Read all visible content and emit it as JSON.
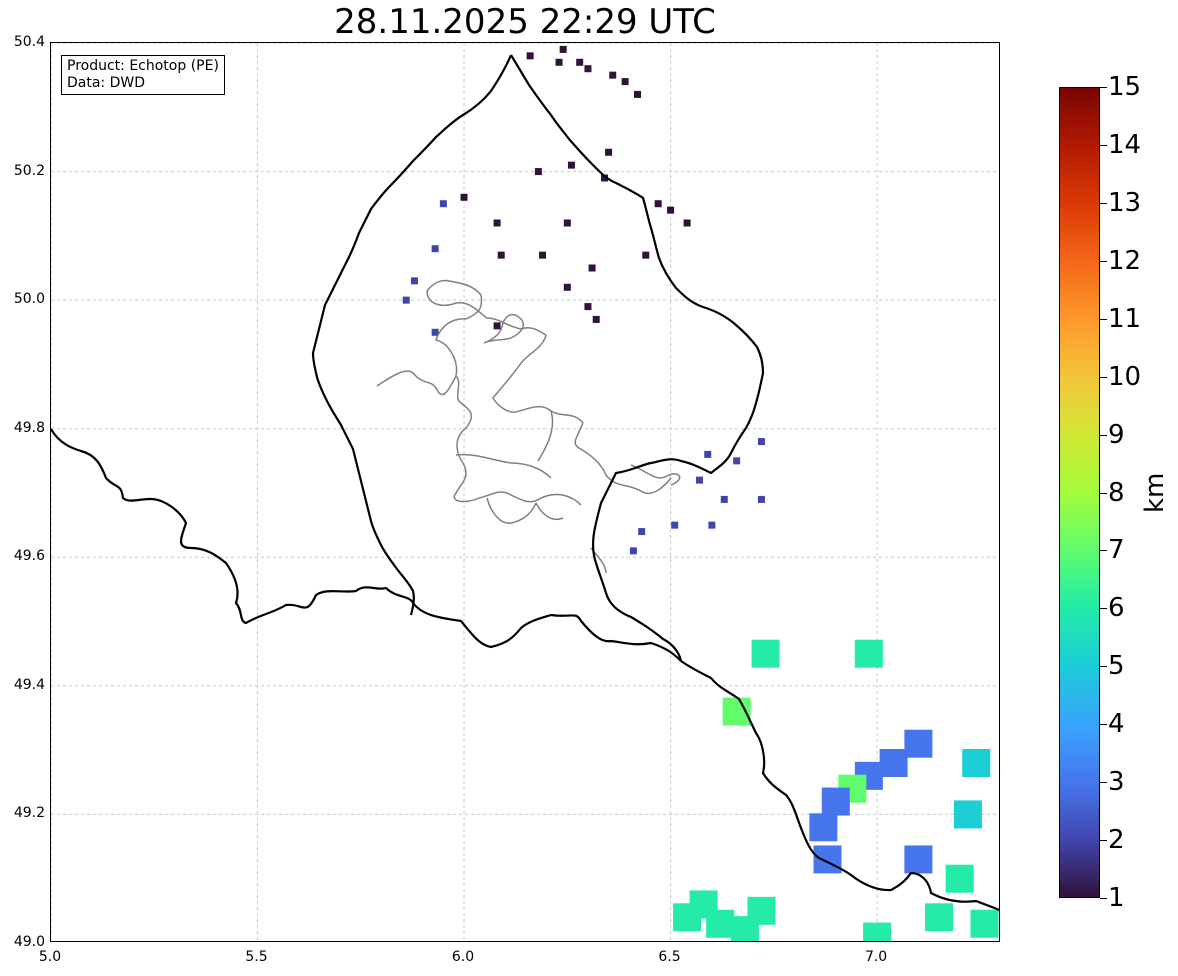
{
  "title": "28.11.2025 22:29 UTC",
  "info_box": {
    "product": "Product: Echotop (PE)",
    "data": "Data: DWD"
  },
  "axes": {
    "lon_ticks": [
      "5.0",
      "5.5",
      "6.0",
      "6.5",
      "7.0"
    ],
    "lat_ticks": [
      "50.4",
      "50.2",
      "50.0",
      "49.8",
      "49.6",
      "49.4",
      "49.2",
      "49.0"
    ],
    "lon_range": [
      5.0,
      7.3
    ],
    "lat_range": [
      49.0,
      50.4
    ],
    "grid": true
  },
  "colorbar": {
    "label": "km",
    "ticks": [
      "15",
      "14",
      "13",
      "12",
      "11",
      "10",
      "9",
      "8",
      "7",
      "6",
      "5",
      "4",
      "3",
      "2",
      "1"
    ],
    "range": [
      1,
      15
    ],
    "colormap": "turbo"
  },
  "chart_data": {
    "type": "heatmap",
    "title": "28.11.2025 22:29 UTC",
    "xlabel": "",
    "ylabel": "",
    "xlim": [
      5.0,
      7.3
    ],
    "ylim": [
      49.0,
      50.4
    ],
    "unit": "km",
    "cells": [
      {
        "lon": 6.16,
        "lat": 50.38,
        "value": 1.2
      },
      {
        "lon": 6.24,
        "lat": 50.39,
        "value": 1.2
      },
      {
        "lon": 6.28,
        "lat": 50.37,
        "value": 1.2
      },
      {
        "lon": 6.36,
        "lat": 50.35,
        "value": 1.3
      },
      {
        "lon": 6.23,
        "lat": 50.37,
        "value": 1.2
      },
      {
        "lon": 6.39,
        "lat": 50.34,
        "value": 1.2
      },
      {
        "lon": 6.42,
        "lat": 50.32,
        "value": 1.3
      },
      {
        "lon": 6.3,
        "lat": 50.36,
        "value": 1.2
      },
      {
        "lon": 6.18,
        "lat": 50.2,
        "value": 1.2
      },
      {
        "lon": 6.26,
        "lat": 50.21,
        "value": 1.2
      },
      {
        "lon": 6.35,
        "lat": 50.23,
        "value": 1.2
      },
      {
        "lon": 6.34,
        "lat": 50.19,
        "value": 1.2
      },
      {
        "lon": 6.47,
        "lat": 50.15,
        "value": 1.1
      },
      {
        "lon": 6.54,
        "lat": 50.12,
        "value": 1.1
      },
      {
        "lon": 6.5,
        "lat": 50.14,
        "value": 1.1
      },
      {
        "lon": 6.44,
        "lat": 50.07,
        "value": 1.3
      },
      {
        "lon": 6.25,
        "lat": 50.12,
        "value": 1.2
      },
      {
        "lon": 6.31,
        "lat": 50.05,
        "value": 1.2
      },
      {
        "lon": 6.25,
        "lat": 50.02,
        "value": 1.2
      },
      {
        "lon": 6.3,
        "lat": 49.99,
        "value": 1.1
      },
      {
        "lon": 6.32,
        "lat": 49.97,
        "value": 1.2
      },
      {
        "lon": 6.19,
        "lat": 50.07,
        "value": 1.2
      },
      {
        "lon": 6.09,
        "lat": 50.07,
        "value": 1.3
      },
      {
        "lon": 6.0,
        "lat": 50.16,
        "value": 1.4
      },
      {
        "lon": 5.95,
        "lat": 50.15,
        "value": 1.5
      },
      {
        "lon": 6.08,
        "lat": 50.12,
        "value": 1.4
      },
      {
        "lon": 5.93,
        "lat": 50.08,
        "value": 1.5
      },
      {
        "lon": 5.88,
        "lat": 50.03,
        "value": 1.6
      },
      {
        "lon": 5.86,
        "lat": 50.0,
        "value": 1.6
      },
      {
        "lon": 5.93,
        "lat": 49.95,
        "value": 1.6
      },
      {
        "lon": 6.08,
        "lat": 49.96,
        "value": 1.4
      },
      {
        "lon": 6.59,
        "lat": 49.76,
        "value": 1.8
      },
      {
        "lon": 6.66,
        "lat": 49.75,
        "value": 1.9
      },
      {
        "lon": 6.72,
        "lat": 49.78,
        "value": 1.8
      },
      {
        "lon": 6.57,
        "lat": 49.72,
        "value": 1.8
      },
      {
        "lon": 6.63,
        "lat": 49.69,
        "value": 1.8
      },
      {
        "lon": 6.6,
        "lat": 49.65,
        "value": 1.9
      },
      {
        "lon": 6.51,
        "lat": 49.65,
        "value": 1.9
      },
      {
        "lon": 6.41,
        "lat": 49.61,
        "value": 2.0
      },
      {
        "lon": 6.43,
        "lat": 49.64,
        "value": 2.0
      },
      {
        "lon": 6.72,
        "lat": 49.69,
        "value": 1.9
      },
      {
        "lon": 6.73,
        "lat": 49.45,
        "value": 6.3
      },
      {
        "lon": 6.98,
        "lat": 49.45,
        "value": 5.8
      },
      {
        "lon": 6.66,
        "lat": 49.36,
        "value": 6.5
      },
      {
        "lon": 7.1,
        "lat": 49.31,
        "value": 3.0
      },
      {
        "lon": 7.04,
        "lat": 49.28,
        "value": 3.0
      },
      {
        "lon": 6.98,
        "lat": 49.26,
        "value": 3.0
      },
      {
        "lon": 6.94,
        "lat": 49.24,
        "value": 6.8
      },
      {
        "lon": 6.9,
        "lat": 49.22,
        "value": 3.1
      },
      {
        "lon": 6.87,
        "lat": 49.18,
        "value": 3.2
      },
      {
        "lon": 6.88,
        "lat": 49.13,
        "value": 3.2
      },
      {
        "lon": 7.1,
        "lat": 49.13,
        "value": 3.0
      },
      {
        "lon": 7.24,
        "lat": 49.28,
        "value": 5.2
      },
      {
        "lon": 7.22,
        "lat": 49.2,
        "value": 5.4
      },
      {
        "lon": 7.2,
        "lat": 49.1,
        "value": 5.7
      },
      {
        "lon": 7.15,
        "lat": 49.04,
        "value": 6.0
      },
      {
        "lon": 7.26,
        "lat": 49.03,
        "value": 6.2
      },
      {
        "lon": 7.0,
        "lat": 49.01,
        "value": 5.8
      },
      {
        "lon": 6.58,
        "lat": 49.06,
        "value": 5.6
      },
      {
        "lon": 6.62,
        "lat": 49.03,
        "value": 5.7
      },
      {
        "lon": 6.68,
        "lat": 49.02,
        "value": 5.9
      },
      {
        "lon": 6.72,
        "lat": 49.05,
        "value": 6.0
      },
      {
        "lon": 6.54,
        "lat": 49.04,
        "value": 5.6
      }
    ]
  }
}
